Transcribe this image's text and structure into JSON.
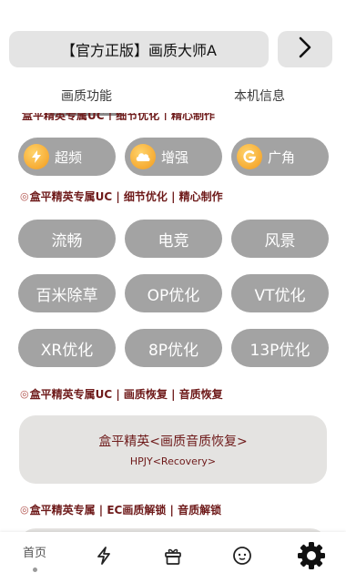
{
  "header": {
    "title": "【官方正版】画质大师A",
    "next_icon": "chevron-right-icon"
  },
  "tabs": [
    {
      "label": "画质功能",
      "active": true
    },
    {
      "label": "本机信息",
      "active": false
    }
  ],
  "feature_buttons": [
    {
      "label": "超频",
      "icon": "lightning-orange-icon"
    },
    {
      "label": "增强",
      "icon": "cloud-orange-icon"
    },
    {
      "label": "广角",
      "icon": "g-orange-icon"
    }
  ],
  "sections": {
    "uc_detail": {
      "mark": "◎",
      "label": "盒平精英专属UC | 细节优化 | 精心制作",
      "buttons": [
        "流畅",
        "电竞",
        "风景",
        "百米除草",
        "OP优化",
        "VT优化",
        "XR优化",
        "8P优化",
        "13P优化"
      ]
    },
    "uc_recovery": {
      "mark": "◎",
      "label": "盒平精英专属UC | 画质恢复 | 音质恢复",
      "card_title": "盒平精英<画质音质恢复>",
      "card_subtitle": "HPJY<Recovery>"
    },
    "ec_unlock": {
      "mark": "◎",
      "label": "盒平精英专属 | EC画质解锁 | 音质解锁"
    }
  },
  "bottom_nav": [
    {
      "label": "首页",
      "icon": "",
      "active": true
    },
    {
      "label": "",
      "icon": "lightning-icon"
    },
    {
      "label": "",
      "icon": "gift-icon"
    },
    {
      "label": "",
      "icon": "face-icon"
    },
    {
      "label": "",
      "icon": "gear-icon"
    }
  ],
  "colors": {
    "pill_bg": "#a3a3a3",
    "card_bg": "#e4e4e4",
    "label_red": "#6e1a1a",
    "accent_orange": "#f29a1c"
  }
}
